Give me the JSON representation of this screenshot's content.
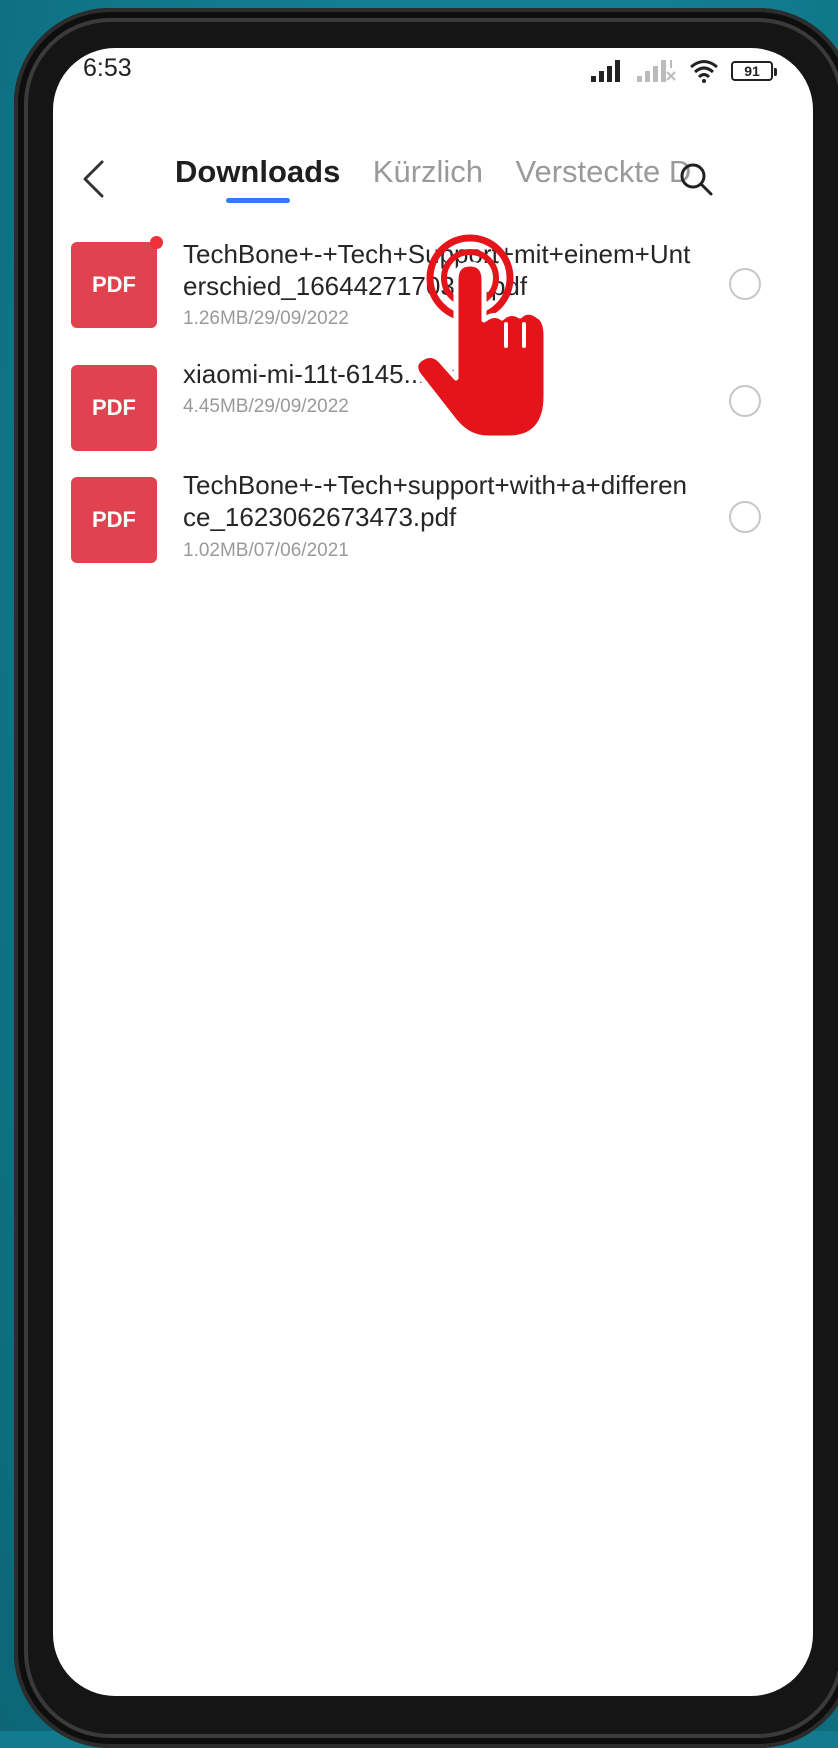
{
  "status_bar": {
    "time": "6:53",
    "battery": "91"
  },
  "header": {
    "tabs": [
      {
        "label": "Downloads",
        "active": true
      },
      {
        "label": "Kürzlich",
        "active": false
      },
      {
        "label": "Versteckte D",
        "active": false
      }
    ]
  },
  "files": [
    {
      "icon_label": "PDF",
      "name": "TechBone+-+Tech+Support+mit+einem+Unterschied_1664427170348.pdf",
      "meta": "1.26MB/29/09/2022",
      "is_new": true
    },
    {
      "icon_label": "PDF",
      "name": "xiaomi-mi-11t-6145...e.pdf",
      "meta": "4.45MB/29/09/2022",
      "is_new": false
    },
    {
      "icon_label": "PDF",
      "name": "TechBone+-+Tech+support+with+a+difference_1623062673473.pdf",
      "meta": "1.02MB/07/06/2021",
      "is_new": false
    }
  ],
  "colors": {
    "background": "#127c8e",
    "pdf_icon": "#e0434f",
    "tab_underline": "#2f7cf6",
    "tap_hand": "#e5141b"
  },
  "icons": {
    "back": "chevron-left-icon",
    "search": "search-icon",
    "tap": "tap-hand-icon"
  }
}
